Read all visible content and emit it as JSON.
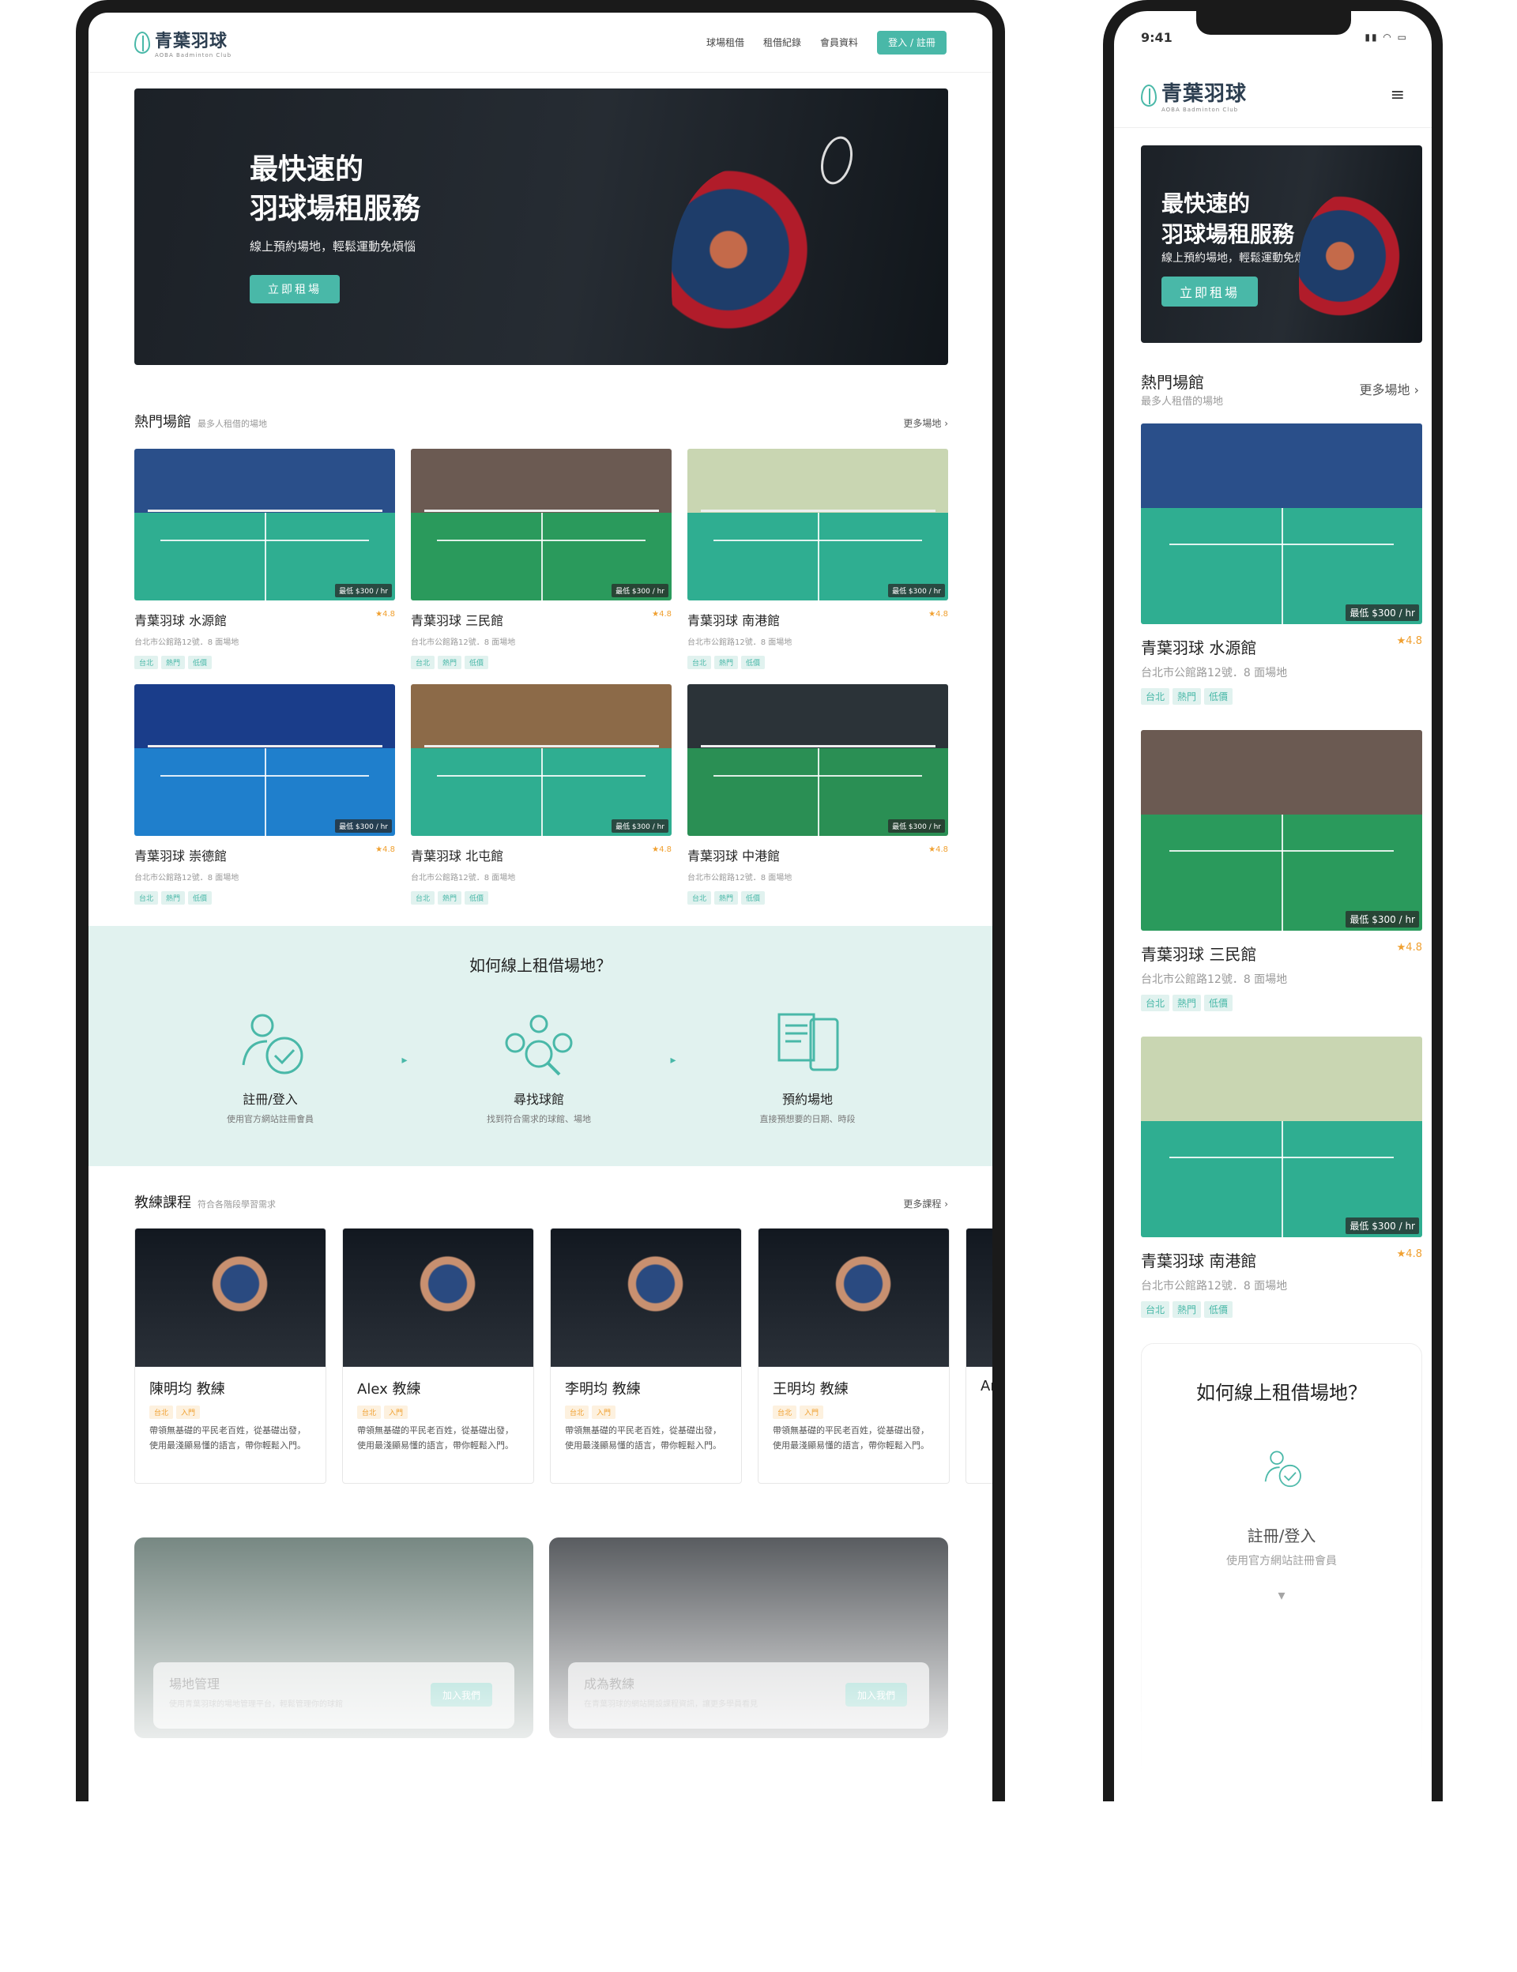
{
  "brand": {
    "name": "青葉羽球",
    "sub": "AOBA Badminton Club"
  },
  "nav": {
    "items": [
      "球場租借",
      "租借紀錄",
      "會員資料"
    ],
    "login": "登入 / 註冊"
  },
  "hero": {
    "title1": "最快速的",
    "title2": "羽球場租服務",
    "subtitle": "線上預約場地，輕鬆運動免煩惱",
    "cta": "立即租場"
  },
  "venues": {
    "title": "熱門場館",
    "subtitle": "最多人租借的場地",
    "more": "更多場地",
    "items": [
      {
        "name": "青葉羽球 水源館",
        "rating": "★4.8",
        "addr": "台北市公館路12號．8 面場地",
        "price": "最低 $300 / hr",
        "tags": [
          "台北",
          "熱門",
          "低價"
        ]
      },
      {
        "name": "青葉羽球 三民館",
        "rating": "★4.8",
        "addr": "台北市公館路12號．8 面場地",
        "price": "最低 $300 / hr",
        "tags": [
          "台北",
          "熱門",
          "低價"
        ]
      },
      {
        "name": "青葉羽球 南港館",
        "rating": "★4.8",
        "addr": "台北市公館路12號．8 面場地",
        "price": "最低 $300 / hr",
        "tags": [
          "台北",
          "熱門",
          "低價"
        ]
      },
      {
        "name": "青葉羽球 崇德館",
        "rating": "★4.8",
        "addr": "台北市公館路12號．8 面場地",
        "price": "最低 $300 / hr",
        "tags": [
          "台北",
          "熱門",
          "低價"
        ]
      },
      {
        "name": "青葉羽球 北屯館",
        "rating": "★4.8",
        "addr": "台北市公館路12號．8 面場地",
        "price": "最低 $300 / hr",
        "tags": [
          "台北",
          "熱門",
          "低價"
        ]
      },
      {
        "name": "青葉羽球 中港館",
        "rating": "★4.8",
        "addr": "台北市公館路12號．8 面場地",
        "price": "最低 $300 / hr",
        "tags": [
          "台北",
          "熱門",
          "低價"
        ]
      }
    ]
  },
  "how": {
    "title": "如何線上租借場地？",
    "steps": [
      {
        "title": "註冊/登入",
        "desc": "使用官方網站註冊會員"
      },
      {
        "title": "尋找球館",
        "desc": "找到符合需求的球館、場地"
      },
      {
        "title": "預約場地",
        "desc": "直接預想要的日期、時段"
      }
    ]
  },
  "coaches": {
    "title": "教練課程",
    "subtitle": "符合各階段學習需求",
    "more": "更多課程",
    "items": [
      {
        "name": "陳明均 教練",
        "tags": [
          "台北",
          "入門"
        ],
        "desc": "帶領無基礎的平民老百姓，從基礎出發，使用最淺顯易懂的語言，帶你輕鬆入門。"
      },
      {
        "name": "Alex 教練",
        "tags": [
          "台北",
          "入門"
        ],
        "desc": "帶領無基礎的平民老百姓，從基礎出發，使用最淺顯易懂的語言，帶你輕鬆入門。"
      },
      {
        "name": "李明均 教練",
        "tags": [
          "台北",
          "入門"
        ],
        "desc": "帶領無基礎的平民老百姓，從基礎出發，使用最淺顯易懂的語言，帶你輕鬆入門。"
      },
      {
        "name": "王明均 教練",
        "tags": [
          "台北",
          "入門"
        ],
        "desc": "帶領無基礎的平民老百姓，從基礎出發，使用最淺顯易懂的語言，帶你輕鬆入門。"
      },
      {
        "name": "Ar"
      }
    ]
  },
  "join": [
    {
      "title": "場地管理",
      "desc": "使用青葉羽球的場地管理平台，輕鬆管理你的球館",
      "btn": "加入我們"
    },
    {
      "title": "成為教練",
      "desc": "在青葉羽球的網站開設課程資訊，讓更多學員看見",
      "btn": "加入我們"
    }
  ],
  "mobile": {
    "time": "9:41",
    "more": "更多場地"
  },
  "colors": {
    "accent": "#49b8a8",
    "light": "#e1f2ef"
  }
}
